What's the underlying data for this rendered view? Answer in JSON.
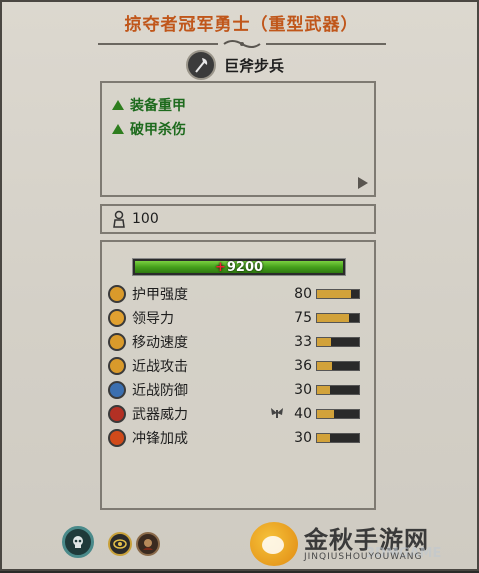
{
  "header": {
    "title": "掠夺者冠军勇士（重型武器）"
  },
  "unit": {
    "name": "巨斧步兵",
    "icon": "axe-icon"
  },
  "abilities": [
    {
      "label": "装备重甲",
      "icon": "green-triangle-icon"
    },
    {
      "label": "破甲杀伤",
      "icon": "green-triangle-icon"
    }
  ],
  "men": {
    "value": "100",
    "icon": "soldier-icon"
  },
  "health": {
    "value": "9200",
    "fill": 1.0
  },
  "stats": [
    {
      "label": "护甲强度",
      "value": "80",
      "modifier": "",
      "fill": 0.8,
      "icon": "armour-icon",
      "color": "#d99a2b"
    },
    {
      "label": "领导力",
      "value": "75",
      "modifier": "",
      "fill": 0.75,
      "icon": "leadership-icon",
      "color": "#e0a030"
    },
    {
      "label": "移动速度",
      "value": "33",
      "modifier": "",
      "fill": 0.33,
      "icon": "speed-icon",
      "color": "#d99a2b"
    },
    {
      "label": "近战攻击",
      "value": "36",
      "modifier": "",
      "fill": 0.36,
      "icon": "melee-attack-icon",
      "color": "#d99a2b"
    },
    {
      "label": "近战防御",
      "value": "30",
      "modifier": "",
      "fill": 0.3,
      "icon": "melee-defence-icon",
      "color": "#3b6fb0"
    },
    {
      "label": "武器威力",
      "value": "40",
      "modifier": "moth-icon",
      "fill": 0.4,
      "icon": "weapon-strength-icon",
      "color": "#b33024"
    },
    {
      "label": "冲锋加成",
      "value": "30",
      "modifier": "",
      "fill": 0.3,
      "icon": "charge-bonus-icon",
      "color": "#d04a1a"
    }
  ],
  "bottom": {
    "icons": [
      "unit-skull-icon",
      "eye-icon",
      "warrior-portrait-icon"
    ]
  },
  "watermark": {
    "main": "金秋手游网",
    "sub": "JINQIUSHOUYOUWANG",
    "brand": "3DMGAME"
  },
  "colors": {
    "title": "#c0561a",
    "ability": "#1d6a1d",
    "health": "#46a01c",
    "bar": "#d2a23a"
  }
}
